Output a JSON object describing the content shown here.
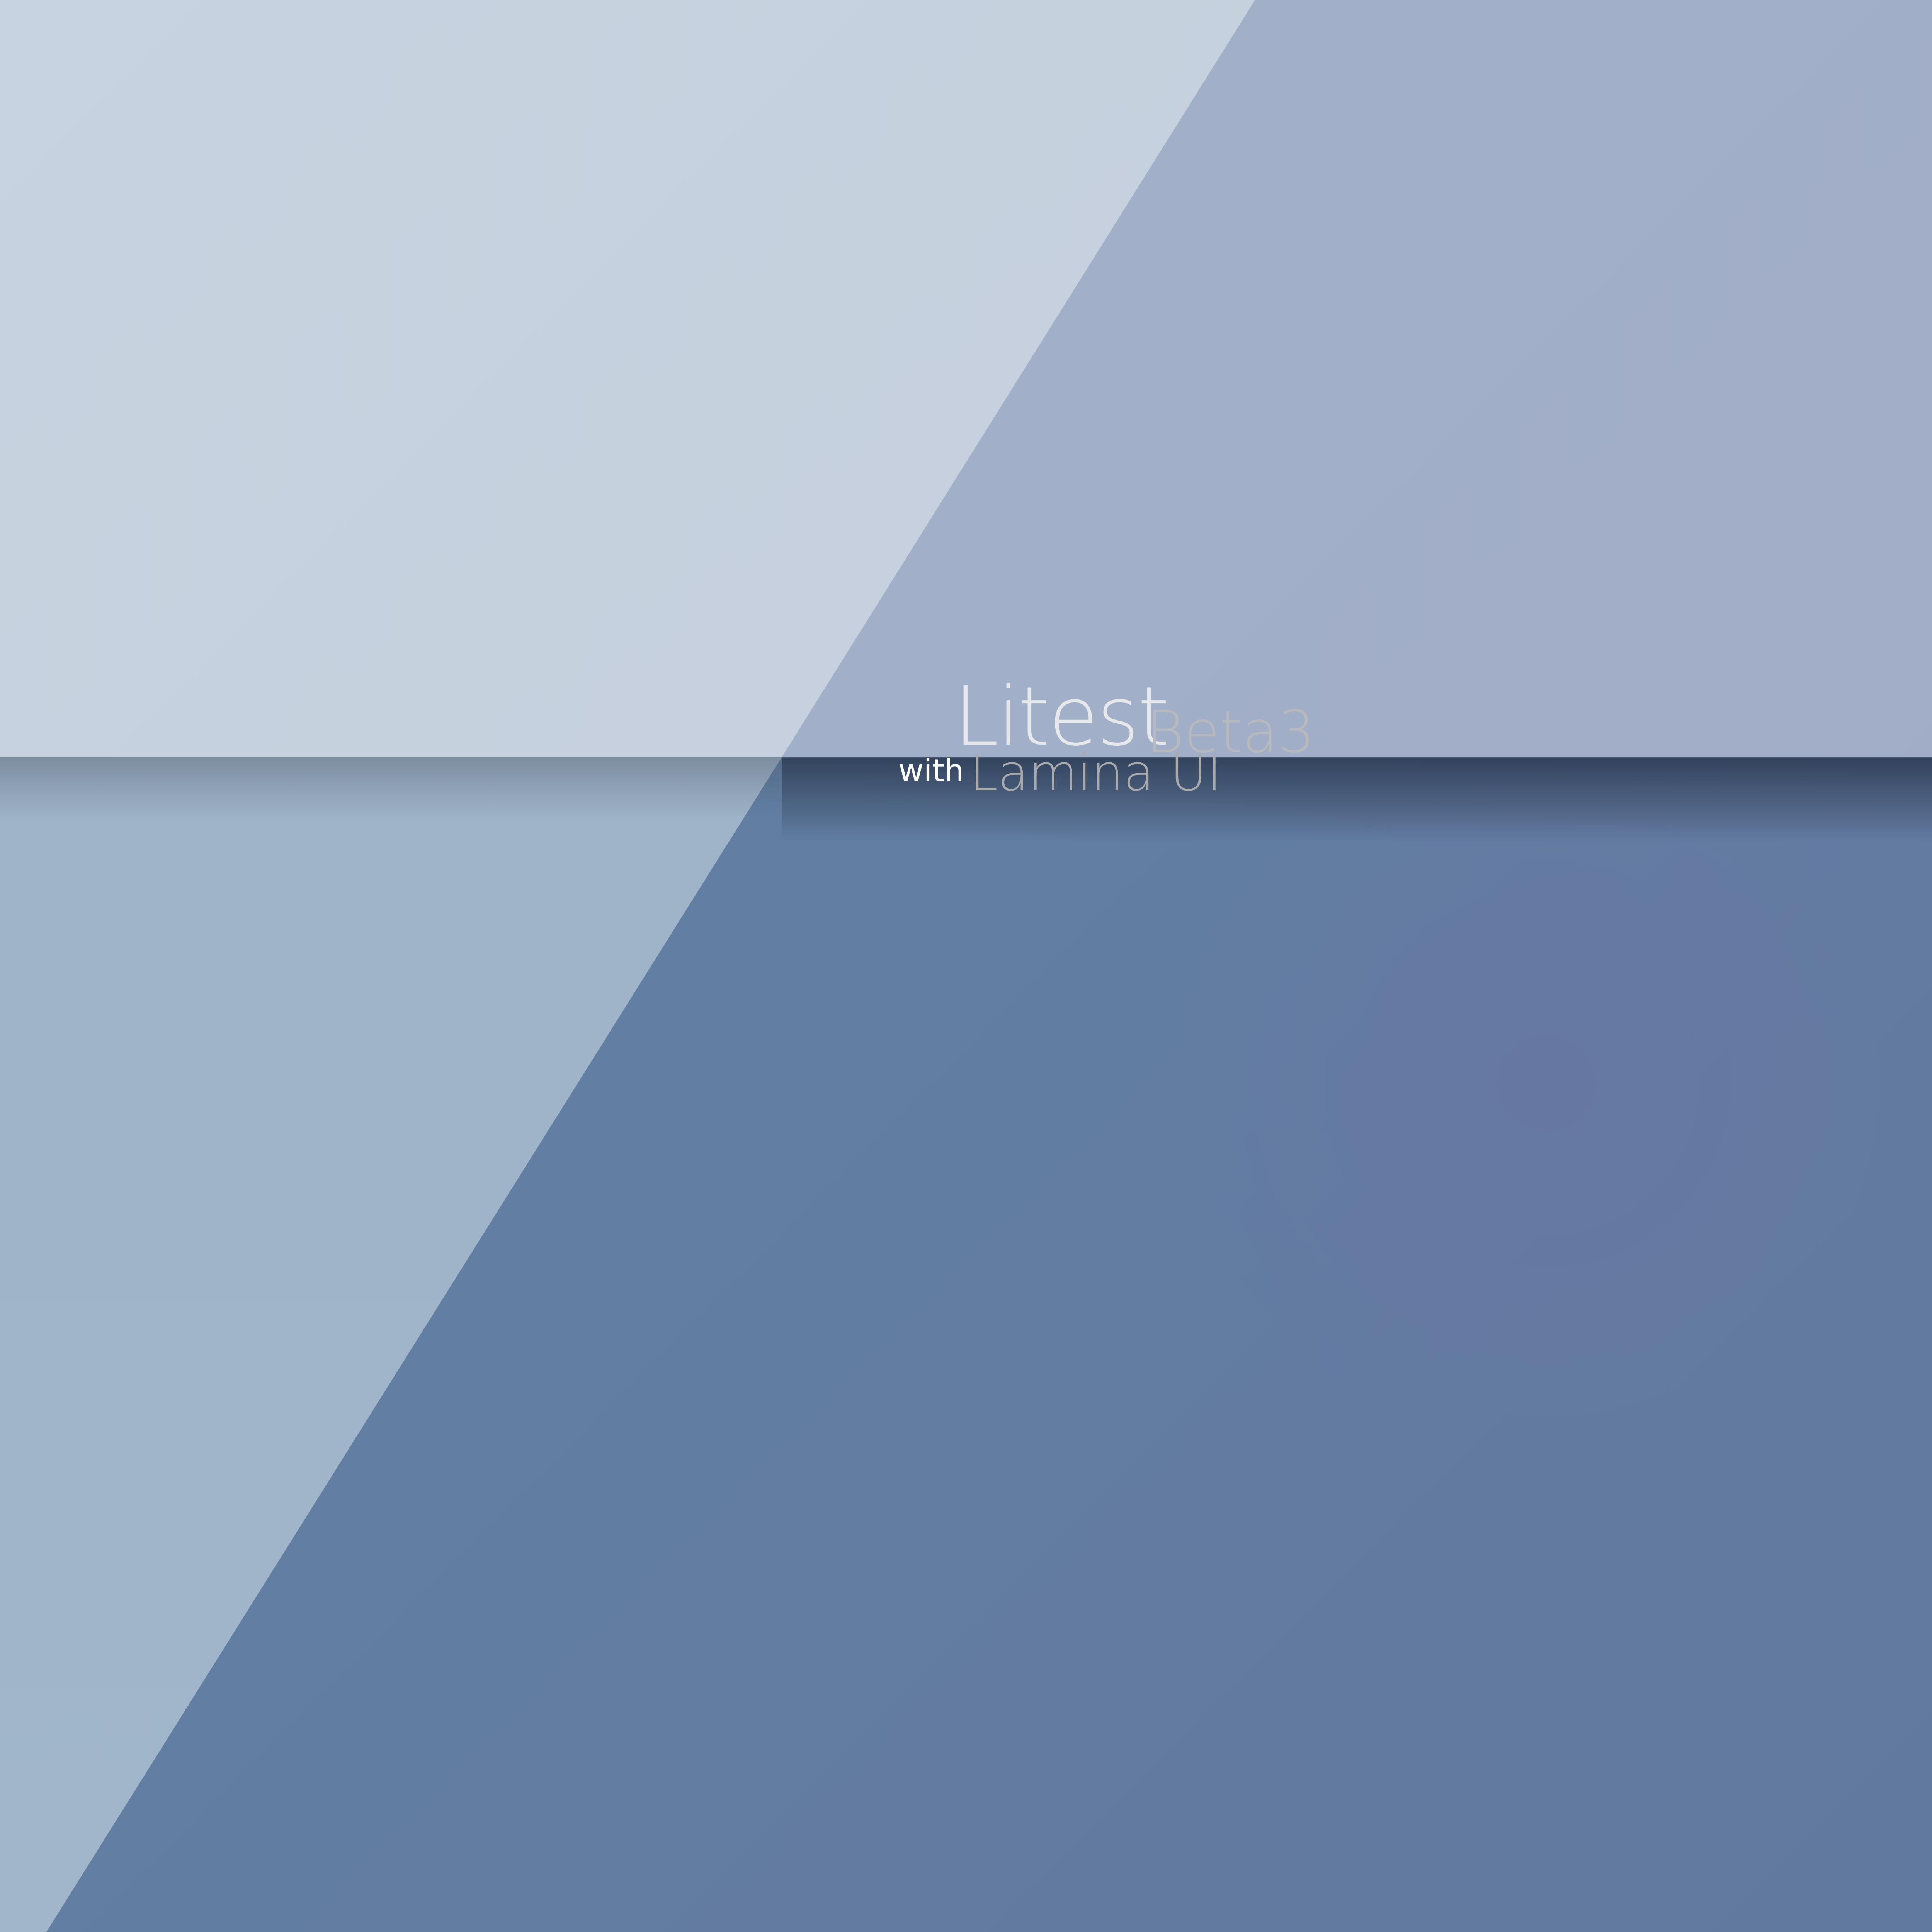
{
  "wallpaper": {
    "brand": {
      "title": "Litest",
      "version": "Beta3",
      "connector": "with",
      "subtitle": "Lamina UI"
    },
    "colors": {
      "top_left_panel": "#c6cfdd",
      "top_right_panel": "#a1b0c8",
      "bottom_left_panel": "#9fb4c9",
      "bottom_right_panel": "#627fa3",
      "title_text": "#e6e8ec",
      "version_text": "#b7b9bd",
      "connector_text": "#ffffff",
      "subtitle_text": "#a8aaad"
    }
  }
}
